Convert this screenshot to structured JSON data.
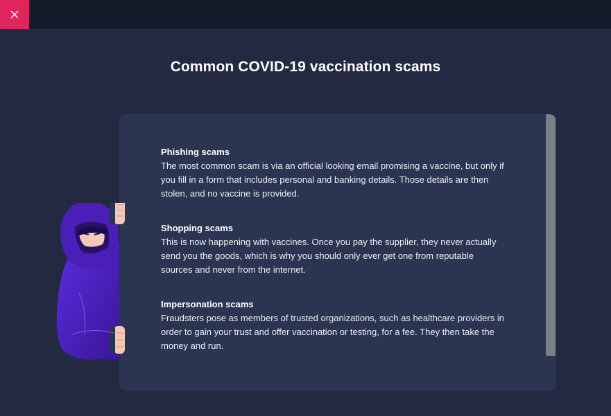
{
  "window": {
    "close_icon": "close-icon"
  },
  "page": {
    "title": "Common COVID-19 vaccination scams"
  },
  "scams": [
    {
      "title": "Phishing scams",
      "description": "The most common scam is via an official looking email promising a vaccine, but only if you fill in a form that includes personal and banking details. Those details are then stolen, and no vaccine is provided."
    },
    {
      "title": "Shopping scams",
      "description": "This is now happening with vaccines. Once you pay the supplier, they never actually send you the goods, which is why you should only ever get one from reputable sources and never from the internet."
    },
    {
      "title": "Impersonation scams",
      "description": "Fraudsters pose as members of trusted organizations, such as healthcare providers in order to gain your trust and offer vaccination or testing, for a fee. They then take the money and run."
    }
  ],
  "colors": {
    "accent": "#e0245e",
    "background": "#222940",
    "card": "#2b3450",
    "figure": "#4a1fb8"
  }
}
